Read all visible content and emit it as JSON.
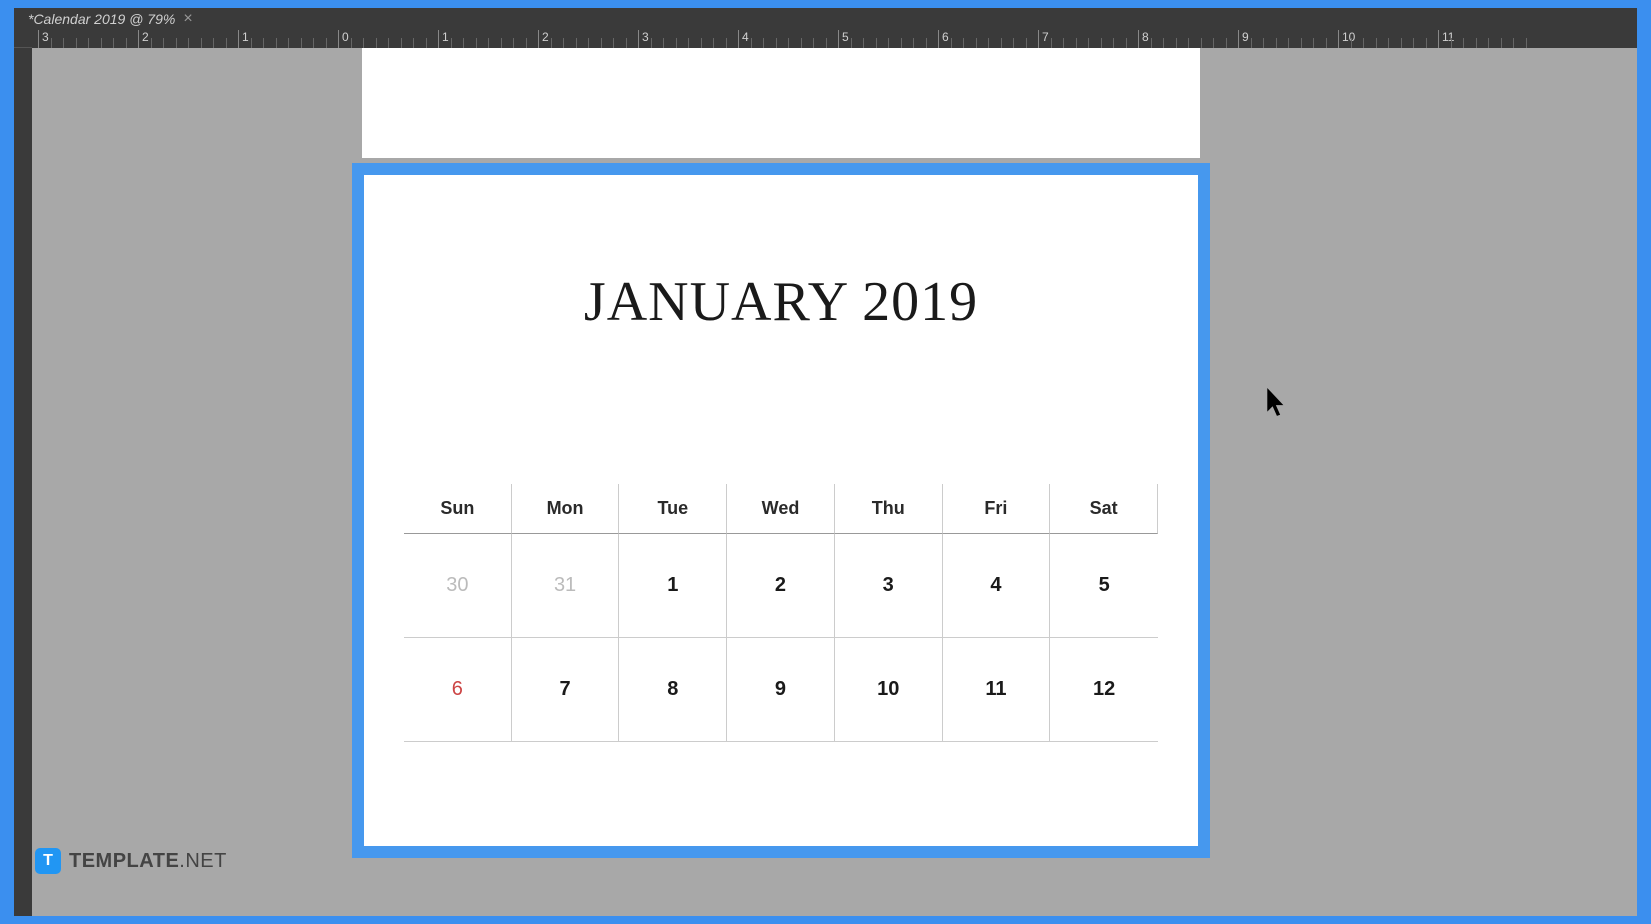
{
  "tab": {
    "title": "*Calendar 2019 @ 79%"
  },
  "ruler": {
    "marks": [
      "3",
      "2",
      "1",
      "0",
      "1",
      "2",
      "3",
      "4",
      "5",
      "6",
      "7",
      "8",
      "9",
      "10",
      "11"
    ]
  },
  "calendar": {
    "title": "JANUARY 2019",
    "day_headers": [
      "Sun",
      "Mon",
      "Tue",
      "Wed",
      "Thu",
      "Fri",
      "Sat"
    ],
    "rows": [
      [
        {
          "val": "30",
          "style": "faded"
        },
        {
          "val": "31",
          "style": "faded"
        },
        {
          "val": "1",
          "style": ""
        },
        {
          "val": "2",
          "style": ""
        },
        {
          "val": "3",
          "style": ""
        },
        {
          "val": "4",
          "style": ""
        },
        {
          "val": "5",
          "style": ""
        }
      ],
      [
        {
          "val": "6",
          "style": "red"
        },
        {
          "val": "7",
          "style": ""
        },
        {
          "val": "8",
          "style": ""
        },
        {
          "val": "9",
          "style": ""
        },
        {
          "val": "10",
          "style": ""
        },
        {
          "val": "11",
          "style": ""
        },
        {
          "val": "12",
          "style": ""
        }
      ]
    ]
  },
  "watermark": {
    "icon_letter": "T",
    "brand": "TEMPLATE",
    "suffix": ".NET"
  }
}
